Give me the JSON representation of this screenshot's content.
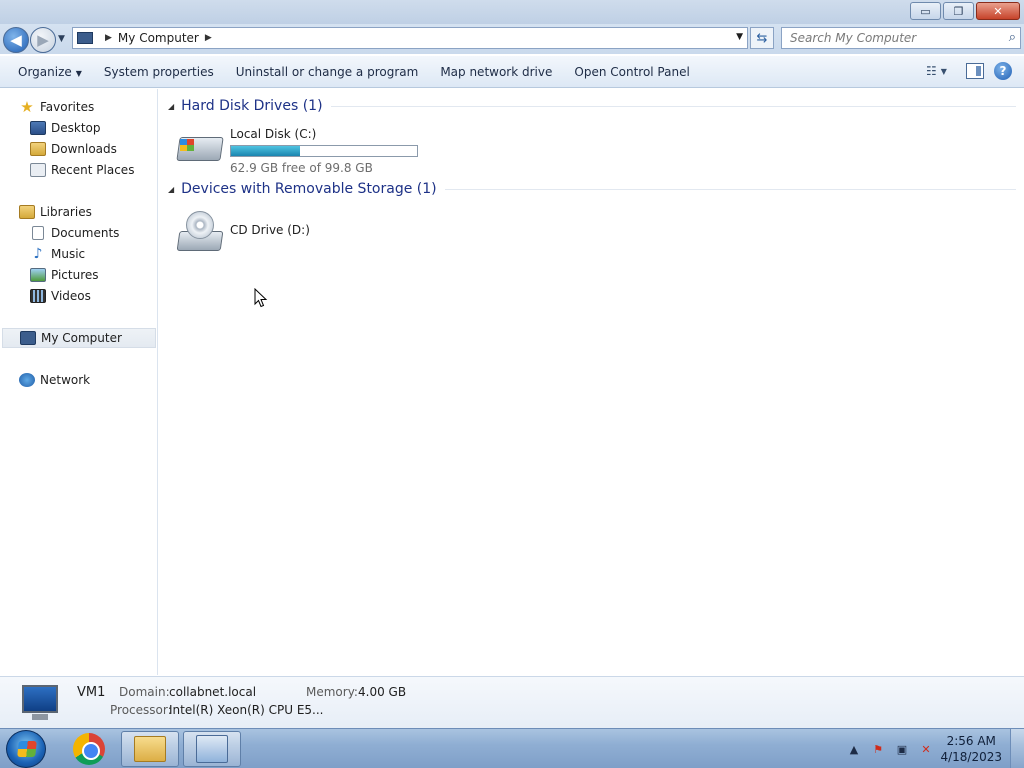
{
  "window": {
    "minimize": "▭",
    "restore": "❐",
    "close": "✕"
  },
  "address": {
    "location": "My Computer",
    "search_placeholder": "Search My Computer"
  },
  "toolbar": {
    "organize": "Organize",
    "system_properties": "System properties",
    "uninstall": "Uninstall or change a program",
    "map_drive": "Map network drive",
    "control_panel": "Open Control Panel"
  },
  "nav": {
    "favorites": "Favorites",
    "desktop": "Desktop",
    "downloads": "Downloads",
    "recent_places": "Recent Places",
    "libraries": "Libraries",
    "documents": "Documents",
    "music": "Music",
    "pictures": "Pictures",
    "videos": "Videos",
    "my_computer": "My Computer",
    "network": "Network"
  },
  "groups": {
    "hard_disks": "Hard Disk Drives (1)",
    "removable": "Devices with Removable Storage (1)"
  },
  "drives": {
    "c": {
      "name": "Local Disk (C:)",
      "free": "62.9 GB free of 99.8 GB",
      "used_fraction": 0.37
    },
    "d": {
      "name": "CD Drive (D:)"
    }
  },
  "details": {
    "computer_name": "VM1",
    "domain_label": "Domain:",
    "domain": "collabnet.local",
    "memory_label": "Memory:",
    "memory": "4.00 GB",
    "processor_label": "Processor:",
    "processor": "Intel(R) Xeon(R) CPU E5..."
  },
  "taskbar": {
    "time": "2:56 AM",
    "date": "4/18/2023"
  },
  "icons": {
    "favorites": "star-icon",
    "network": "globe-icon",
    "search": "magnifier-icon",
    "help": "help-icon"
  },
  "colors": {
    "group_title": "#1e3287",
    "capacity_fill": "#1a85b0"
  }
}
